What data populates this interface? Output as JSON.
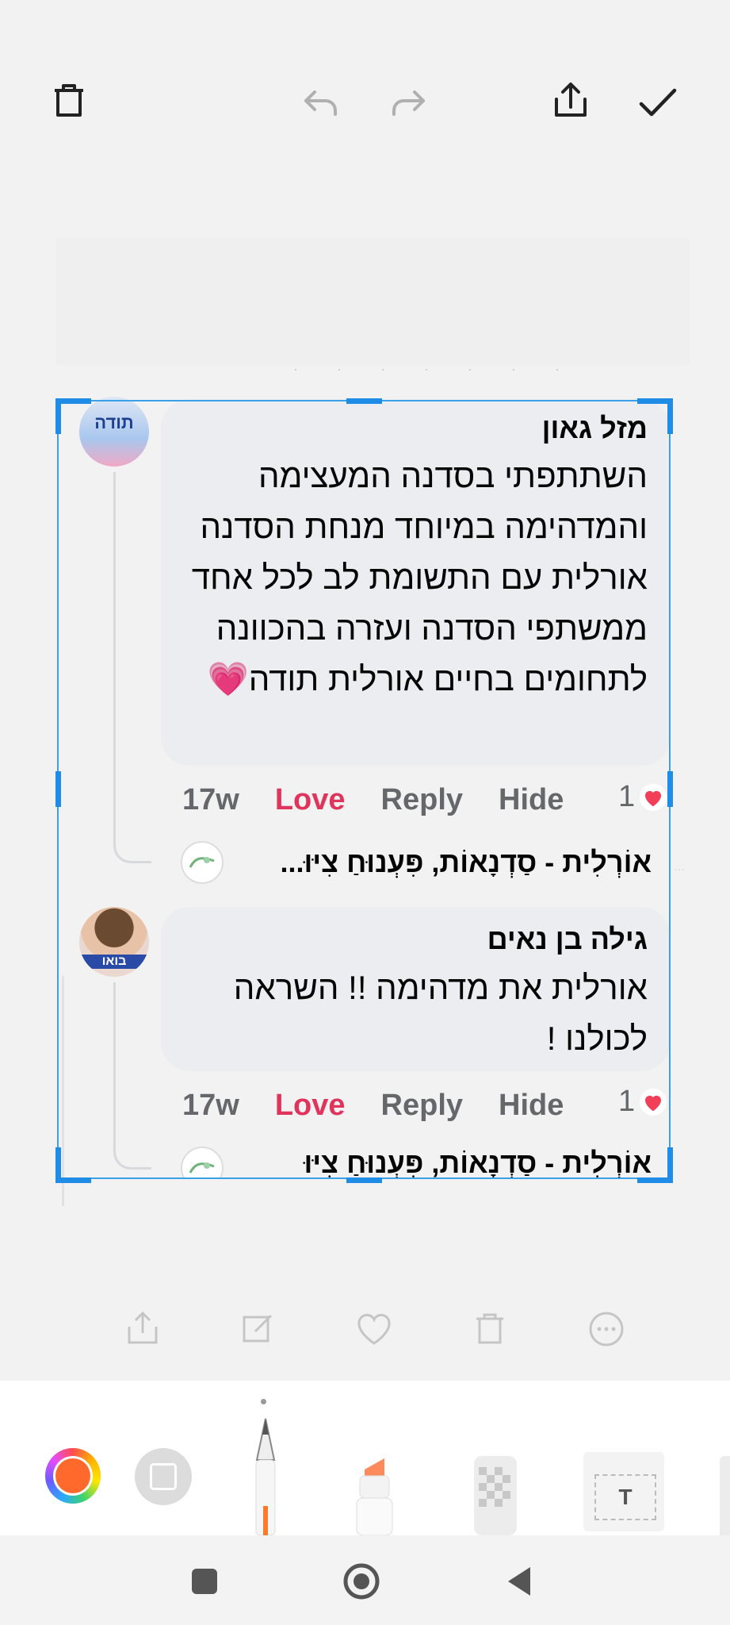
{
  "toolbar": {
    "delete_icon": "trash-icon",
    "undo_icon": "undo-icon",
    "redo_icon": "redo-icon",
    "share_icon": "share-icon",
    "done_icon": "check-icon"
  },
  "comments": [
    {
      "author": "מזל גאון",
      "avatar_text": "תודה",
      "text": "השתתפתי בסדנה המעצימה והמדהימה במיוחד מנחת הסדנה אורלית עם התשומת לב לכל אחד ממשתפי הסדנה ועזרה בהכוונה לתחומים בחיים אורלית תודה💗",
      "time": "17w",
      "love_label": "Love",
      "reply_label": "Reply",
      "hide_label": "Hide",
      "reaction_count": "1",
      "reply_preview": "אוֹרְלִית - סַדְנָאוֹת, פִּעְנוּחַ צִיּוּ..."
    },
    {
      "author": "גילה בן נאים",
      "avatar_text": "בואו",
      "text": "אורלית את מדהימה !! השראה לכולנו !",
      "time": "17w",
      "love_label": "Love",
      "reply_label": "Reply",
      "hide_label": "Hide",
      "reaction_count": "1",
      "reply_preview": "אוֹרְלִית - סַדְנָאוֹת, פִּעְנוּחַ צִיּוּ"
    }
  ],
  "fade_actions": [
    "share-icon",
    "edit-icon",
    "heart-icon",
    "trash-icon",
    "more-icon"
  ],
  "tools": {
    "color_selected": "#ff6a2c",
    "accent": "#1f8ce6",
    "text_tool_label": "T"
  },
  "navbar": [
    "recents-icon",
    "home-icon",
    "back-icon"
  ]
}
